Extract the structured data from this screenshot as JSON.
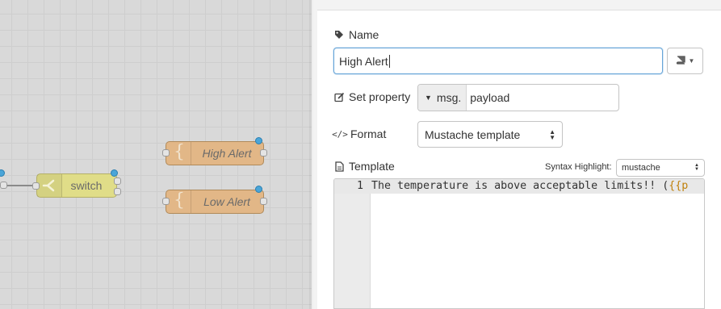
{
  "canvas": {
    "nodes": [
      {
        "label": "switch"
      },
      {
        "label": "High Alert"
      },
      {
        "label": "Low Alert"
      }
    ]
  },
  "editor": {
    "name": {
      "label": "Name",
      "value": "High Alert"
    },
    "property": {
      "label": "Set property",
      "prefix": "msg.",
      "value": "payload"
    },
    "format": {
      "label": "Format",
      "selected": "Mustache template"
    },
    "template": {
      "label": "Template",
      "syntax_label": "Syntax Highlight:",
      "syntax_selected": "mustache",
      "lines": [
        {
          "number": "1",
          "text": "The temperature is above acceptable limits!! (",
          "mustache": "{{p"
        }
      ]
    }
  },
  "icons": [
    "tag-icon",
    "book-icon",
    "edit-icon",
    "code-icon",
    "file-icon",
    "template-icon",
    "switch-icon"
  ],
  "colors": {
    "template_node": "#e2b787",
    "switch_node": "#e0dd88",
    "status_dot": "#4aa5d8",
    "focus_border": "#66a5d8",
    "mustache_token": "#c0810b"
  }
}
